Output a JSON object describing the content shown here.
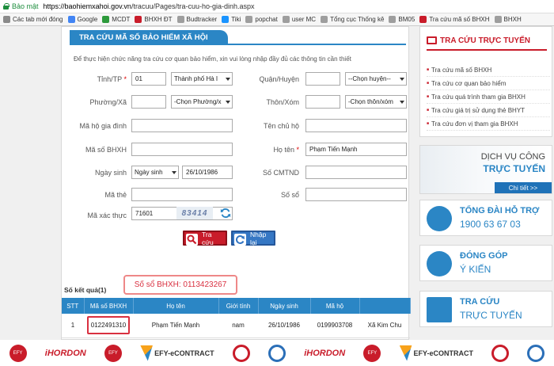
{
  "browser": {
    "secure_label": "Bảo mật",
    "url_host": "https://baohiemxahoi.gov.vn",
    "url_path": "/tracuu/Pages/tra-cuu-ho-gia-dinh.aspx",
    "bookmarks": [
      {
        "label": "Các tab mới đóng",
        "color": "#8a8a8a"
      },
      {
        "label": "Google",
        "color": "#4285f4"
      },
      {
        "label": "MCDT",
        "color": "#2e9a3c"
      },
      {
        "label": "BHXH ĐT",
        "color": "#c91c2a"
      },
      {
        "label": "Budtracker",
        "color": "#9e9e9e"
      },
      {
        "label": "Tiki",
        "color": "#1a94ff"
      },
      {
        "label": "popchat",
        "color": "#9e9e9e"
      },
      {
        "label": "user MC",
        "color": "#9e9e9e"
      },
      {
        "label": "Tổng cục Thống kê",
        "color": "#9e9e9e"
      },
      {
        "label": "BM05",
        "color": "#9e9e9e"
      },
      {
        "label": "Tra cứu mã số BHXH",
        "color": "#c91c2a"
      },
      {
        "label": "BHXH",
        "color": "#9e9e9e"
      }
    ]
  },
  "form": {
    "title": "TRA CỨU MÃ SỐ BẢO HIỂM XÃ HỘI",
    "intro": "Để thực hiện chức năng tra cứu cơ quan bảo hiểm, xin vui lòng nhập đầy đủ các thông tin cần thiết",
    "labels": {
      "tinh": "Tỉnh/TP",
      "quan": "Quận/Huyện",
      "phuong": "Phường/Xã",
      "thon": "Thôn/Xóm",
      "ma_ho": "Mã hộ gia đình",
      "chu_ho": "Tên chủ hộ",
      "ma_bhxh": "Mã số BHXH",
      "ho_ten": "Họ tên",
      "ngay_sinh": "Ngày sinh",
      "cmtnd": "Số CMTND",
      "ma_the": "Mã thẻ",
      "so_so": "Số sổ",
      "captcha": "Mã xác thực"
    },
    "required_mark": "*",
    "values": {
      "tinh_code": "01",
      "tinh_select": "Thành phố Hà I",
      "quan_select": "--Chọn huyện--",
      "phuong_select": "-Chọn Phường/x",
      "thon_select": "-Chọn thôn/xóm",
      "ho_ten": "Phạm Tiến Mạnh",
      "ngay_sinh_type": "Ngày sinh",
      "ngay_sinh": "26/10/1986",
      "captcha_input": "71601",
      "captcha_image": "83414"
    },
    "buttons": {
      "search": "Tra cứu",
      "reset": "Nhập lại"
    }
  },
  "results": {
    "count_label": "Số kết quả(1)",
    "bhxh_note": "Số sổ BHXH: 0113423267",
    "columns": [
      "STT",
      "Mã số BHXH",
      "Họ tên",
      "Giới tính",
      "Ngày sinh",
      "Mã hộ",
      ""
    ],
    "rows": [
      [
        "1",
        "0122491310",
        "Phạm Tiến Mạnh",
        "nam",
        "26/10/1986",
        "0199903708",
        "Xã Kim Chu"
      ]
    ]
  },
  "sidebar": {
    "title": "TRA CỨU TRỰC TUYẾN",
    "links": [
      "Tra cứu mã số BHXH",
      "Tra cứu cơ quan bảo hiểm",
      "Tra cứu quá trình tham gia BHXH",
      "Tra cứu giá trị sử dụng thẻ BHYT",
      "Tra cứu đơn vị tham gia BHXH"
    ],
    "dv_line1": "DỊCH VỤ CÔNG",
    "dv_line2": "TRỰC TUYẾN",
    "dv_more": "Chi tiết >>",
    "hotline_title": "TỔNG ĐÀI HỖ TRỢ",
    "hotline_number": "1900 63 67 03",
    "feedback_title": "ĐÓNG GÓP",
    "feedback_sub": "Ý KIẾN",
    "lookup_title": "TRA CỨU",
    "lookup_sub": "TRỰC TUYẾN"
  },
  "ads": {
    "efy": "EFY",
    "hordon": "iHORDON",
    "contract": "EFY-eCONTRACT"
  }
}
